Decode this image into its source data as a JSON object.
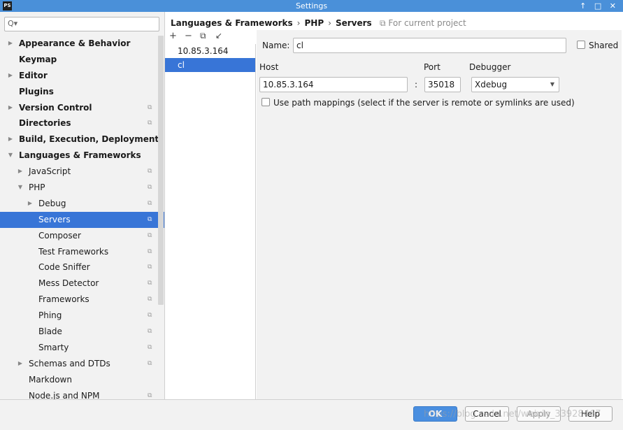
{
  "window": {
    "title": "Settings",
    "logo": "PS",
    "controls": [
      "↑",
      "□",
      "✕"
    ]
  },
  "search": {
    "placeholder": "",
    "icon": "search-icon"
  },
  "tree": [
    {
      "label": "Appearance & Behavior",
      "bold": true,
      "arrow": "▶",
      "indent": 0,
      "proj": false
    },
    {
      "label": "Keymap",
      "bold": true,
      "arrow": "",
      "indent": 0,
      "proj": false
    },
    {
      "label": "Editor",
      "bold": true,
      "arrow": "▶",
      "indent": 0,
      "proj": false
    },
    {
      "label": "Plugins",
      "bold": true,
      "arrow": "",
      "indent": 0,
      "proj": false
    },
    {
      "label": "Version Control",
      "bold": true,
      "arrow": "▶",
      "indent": 0,
      "proj": true
    },
    {
      "label": "Directories",
      "bold": true,
      "arrow": "",
      "indent": 0,
      "proj": true
    },
    {
      "label": "Build, Execution, Deployment",
      "bold": true,
      "arrow": "▶",
      "indent": 0,
      "proj": false
    },
    {
      "label": "Languages & Frameworks",
      "bold": true,
      "arrow": "▼",
      "indent": 0,
      "proj": false
    },
    {
      "label": "JavaScript",
      "bold": false,
      "arrow": "▶",
      "indent": 1,
      "proj": true
    },
    {
      "label": "PHP",
      "bold": false,
      "arrow": "▼",
      "indent": 1,
      "proj": true
    },
    {
      "label": "Debug",
      "bold": false,
      "arrow": "▶",
      "indent": 2,
      "proj": true
    },
    {
      "label": "Servers",
      "bold": false,
      "arrow": "",
      "indent": 2,
      "proj": true,
      "selected": true
    },
    {
      "label": "Composer",
      "bold": false,
      "arrow": "",
      "indent": 2,
      "proj": true
    },
    {
      "label": "Test Frameworks",
      "bold": false,
      "arrow": "",
      "indent": 2,
      "proj": true
    },
    {
      "label": "Code Sniffer",
      "bold": false,
      "arrow": "",
      "indent": 2,
      "proj": true
    },
    {
      "label": "Mess Detector",
      "bold": false,
      "arrow": "",
      "indent": 2,
      "proj": true
    },
    {
      "label": "Frameworks",
      "bold": false,
      "arrow": "",
      "indent": 2,
      "proj": true
    },
    {
      "label": "Phing",
      "bold": false,
      "arrow": "",
      "indent": 2,
      "proj": true
    },
    {
      "label": "Blade",
      "bold": false,
      "arrow": "",
      "indent": 2,
      "proj": true
    },
    {
      "label": "Smarty",
      "bold": false,
      "arrow": "",
      "indent": 2,
      "proj": true
    },
    {
      "label": "Schemas and DTDs",
      "bold": false,
      "arrow": "▶",
      "indent": 1,
      "proj": true
    },
    {
      "label": "Markdown",
      "bold": false,
      "arrow": "",
      "indent": 1,
      "proj": false
    },
    {
      "label": "Node.js and NPM",
      "bold": false,
      "arrow": "",
      "indent": 1,
      "proj": true
    }
  ],
  "breadcrumb": {
    "part1": "Languages & Frameworks",
    "part2": "PHP",
    "part3": "Servers",
    "sep": "›",
    "note": "For current project"
  },
  "server_toolbar": {
    "add": "+",
    "remove": "−",
    "copy": "⧉",
    "import": "↙"
  },
  "servers": [
    {
      "name": "10.85.3.164",
      "selected": false
    },
    {
      "name": "cl",
      "selected": true
    }
  ],
  "form": {
    "name_label": "Name:",
    "name_value": "cl",
    "shared_label": "Shared",
    "host_label": "Host",
    "host_value": "10.85.3.164",
    "port_label": "Port",
    "port_value": "35018",
    "colon": ":",
    "debugger_label": "Debugger",
    "debugger_value": "Xdebug",
    "path_mappings_label": "Use path mappings (select if the server is remote or symlinks are used)"
  },
  "buttons": {
    "ok": "OK",
    "cancel": "Cancel",
    "apply": "Apply",
    "help": "Help"
  },
  "watermark": "https://blog.csdn.net/weixin_33928467",
  "colors": {
    "selection": "#3875d7",
    "titlebar": "#4a90d9",
    "primary_button": "#4a8fe0"
  }
}
